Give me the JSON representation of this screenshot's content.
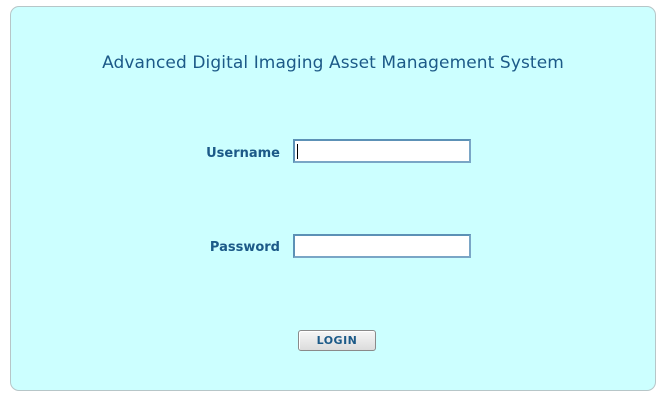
{
  "login": {
    "title": "Advanced Digital Imaging Asset Management System",
    "username_label": "Username",
    "username_value": "",
    "password_label": "Password",
    "password_value": "",
    "login_button_label": "LOGIN"
  },
  "colors": {
    "panel_background": "#ccffff",
    "text_accent": "#1c5a88",
    "input_border": "#5c91b6"
  }
}
